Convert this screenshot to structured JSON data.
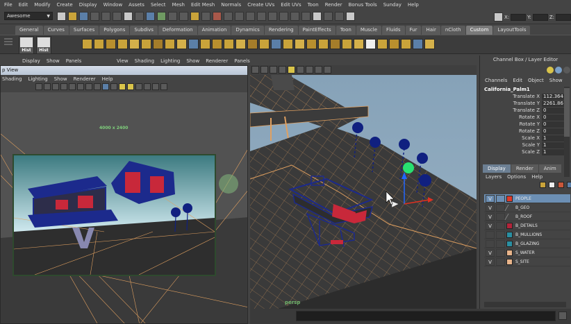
{
  "menubar": [
    "File",
    "Edit",
    "Modify",
    "Create",
    "Display",
    "Window",
    "Assets",
    "Select",
    "Mesh",
    "Edit Mesh",
    "Normals",
    "Create UVs",
    "Edit UVs",
    "Toon",
    "Render",
    "Bonus Tools",
    "Sunday",
    "Help"
  ],
  "status": {
    "menu_set": "Awesome",
    "x_label": "X:",
    "y_label": "Y:",
    "z_label": "Z:"
  },
  "shelf_tabs": [
    "General",
    "Curves",
    "Surfaces",
    "Polygons",
    "Subdivs",
    "Deformation",
    "Animation",
    "Dynamics",
    "Rendering",
    "PaintEffects",
    "Toon",
    "Muscle",
    "Fluids",
    "Fur",
    "Hair",
    "nCloth",
    "Custom",
    "LayoutTools"
  ],
  "shelf_active_tab": "Custom",
  "shelf_buttons": [
    {
      "label": "Hist"
    },
    {
      "label": "Hist"
    }
  ],
  "main_panel_menu": [
    "Display",
    "Show",
    "Panels"
  ],
  "right_panel_menu": [
    "View",
    "Shading",
    "Lighting",
    "Show",
    "Renderer",
    "Panels"
  ],
  "float_window": {
    "title": "p View",
    "menu": [
      "Shading",
      "Lighting",
      "Show",
      "Renderer",
      "Help"
    ],
    "resolution_gate": "4000 x 2400"
  },
  "right_view": {
    "camera_label": "persp"
  },
  "channel_box": {
    "title": "Channel Box / Layer Editor",
    "menu": [
      "Channels",
      "Edit",
      "Object",
      "Show"
    ],
    "object_name": "California_Palm1",
    "attributes": [
      {
        "name": "Translate X",
        "value": "112.364"
      },
      {
        "name": "Translate Y",
        "value": "2261.86"
      },
      {
        "name": "Translate Z",
        "value": "0"
      },
      {
        "name": "Rotate X",
        "value": "0"
      },
      {
        "name": "Rotate Y",
        "value": "0"
      },
      {
        "name": "Rotate Z",
        "value": "0"
      },
      {
        "name": "Scale X",
        "value": "1"
      },
      {
        "name": "Scale Y",
        "value": "1"
      },
      {
        "name": "Scale Z",
        "value": "1"
      }
    ]
  },
  "layer_editor": {
    "tabs": [
      "Display",
      "Render",
      "Anim"
    ],
    "menu": [
      "Layers",
      "Options",
      "Help"
    ],
    "layers": [
      {
        "visible": "V",
        "name": "PEOPLE",
        "color": "#e03a2a",
        "selected": true
      },
      {
        "visible": "V",
        "name": "B_GEO",
        "color": "",
        "selected": false
      },
      {
        "visible": "V",
        "name": "B_ROOF",
        "color": "",
        "selected": false
      },
      {
        "visible": "V",
        "name": "B_DETAILS",
        "color": "#b3243a",
        "selected": false
      },
      {
        "visible": "",
        "name": "B_MULLIONS",
        "color": "#2a8fa2",
        "selected": false
      },
      {
        "visible": "",
        "name": "B_GLAZING",
        "color": "#2a8fa2",
        "selected": false
      },
      {
        "visible": "V",
        "name": "S_WATER",
        "color": "#e8b48a",
        "selected": false
      },
      {
        "visible": "V",
        "name": "S_SITE",
        "color": "#e8b48a",
        "selected": false
      }
    ]
  },
  "colors": {
    "ui_bg": "#444444",
    "viewport_sky": "#8ea9bc",
    "selected_layer": "#6c8fb4",
    "building_blue": "#1c2a8c",
    "building_red": "#c8283a",
    "palm_blue": "#102080"
  }
}
